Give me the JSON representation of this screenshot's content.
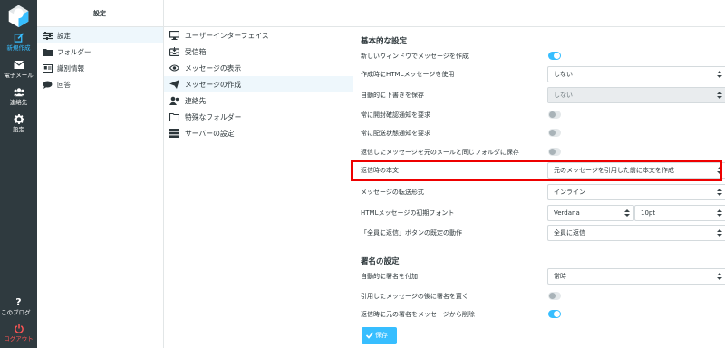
{
  "app": {
    "rail": {
      "compose": "新規作成",
      "mail": "電子メール",
      "contacts": "連絡先",
      "settings": "設定",
      "about": "このブログ...",
      "logout": "ログアウト"
    }
  },
  "settings_menu": {
    "title": "設定",
    "items": [
      {
        "label": "設定",
        "icon": "sliders-icon"
      },
      {
        "label": "フォルダー",
        "icon": "folder-icon"
      },
      {
        "label": "識別情報",
        "icon": "id-card-icon"
      },
      {
        "label": "回答",
        "icon": "chat-icon"
      }
    ]
  },
  "sections_menu": {
    "items": [
      {
        "label": "ユーザーインターフェイス",
        "icon": "monitor-icon"
      },
      {
        "label": "受信箱",
        "icon": "inbox-icon"
      },
      {
        "label": "メッセージの表示",
        "icon": "eye-icon"
      },
      {
        "label": "メッセージの作成",
        "icon": "paper-plane-icon"
      },
      {
        "label": "連絡先",
        "icon": "contacts-icon"
      },
      {
        "label": "特殊なフォルダー",
        "icon": "folder-outline-icon"
      },
      {
        "label": "サーバーの設定",
        "icon": "server-icon"
      }
    ]
  },
  "main": {
    "section_basic": "基本的な設定",
    "rows": [
      {
        "label": "新しいウィンドウでメッセージを作成",
        "type": "toggle",
        "on": true
      },
      {
        "label": "作成時にHTMLメッセージを使用",
        "type": "select",
        "value": "しない"
      },
      {
        "label": "自動的に下書きを保存",
        "type": "select",
        "value": "しない",
        "disabled": true
      },
      {
        "label": "常に開封確認通知を要求",
        "type": "toggle",
        "on": false
      },
      {
        "label": "常に配送状態通知を要求",
        "type": "toggle",
        "on": false
      },
      {
        "label": "返信したメッセージを元のメールと同じフォルダに保存",
        "type": "toggle",
        "on": false
      },
      {
        "label": "返信時の本文",
        "type": "select",
        "value": "元のメッセージを引用した前に本文を作成"
      },
      {
        "label": "メッセージの転送形式",
        "type": "select",
        "value": "インライン"
      },
      {
        "label": "HTMLメッセージの初期フォント",
        "type": "font",
        "font": "Verdana",
        "size": "10pt"
      },
      {
        "label": "「全員に返信」ボタンの既定の動作",
        "type": "select",
        "value": "全員に返信"
      }
    ],
    "section_signature": "署名の設定",
    "sig_rows": [
      {
        "label": "自動的に署名を付加",
        "type": "select",
        "value": "常時"
      },
      {
        "label": "引用したメッセージの後に署名を置く",
        "type": "toggle",
        "on": false
      },
      {
        "label": "返信時に元の署名をメッセージから削除",
        "type": "toggle",
        "on": true
      }
    ],
    "save_label": "保存"
  },
  "colors": {
    "rail_bg": "#2f3a3f",
    "accent": "#37beff",
    "highlight_box": "#ee0000",
    "logout": "#ff5555"
  }
}
